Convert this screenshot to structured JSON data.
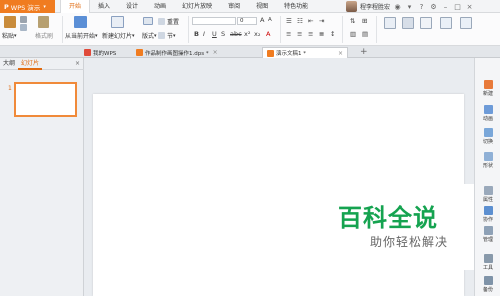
{
  "app": {
    "logo": "P",
    "name": "WPS 演示",
    "arrow": "▾"
  },
  "menu": {
    "tabs": [
      "开始",
      "插入",
      "设计",
      "动画",
      "幻灯片放映",
      "审阅",
      "视图",
      "特色功能"
    ],
    "active_index": 0
  },
  "user": {
    "name": "程李程胜宏"
  },
  "ribbon": {
    "paste": "粘贴",
    "format_painter": "格式刷",
    "from_current": "从当前开始",
    "new_slide": "新建幻灯片",
    "layout": "版式",
    "section": "节",
    "reset": "重置",
    "font_size": "0"
  },
  "doc_tabs": [
    {
      "label": "我的WPS",
      "active": false
    },
    {
      "label": "作品制作画图操作1.dps *",
      "active": false
    },
    {
      "label": "演示文稿1 *",
      "active": true
    }
  ],
  "left_panel": {
    "tabs": [
      "大纲",
      "幻灯片"
    ],
    "active_index": 1,
    "slide_number": "1"
  },
  "right_bar": {
    "items": [
      "新建",
      "动画",
      "切换",
      "形状",
      "属性",
      "协作",
      "管理",
      "工具",
      "备份"
    ]
  },
  "watermark": {
    "title": "百科全说",
    "subtitle": "助你轻松解决"
  },
  "colors": {
    "accent": "#f07c20",
    "watermark_green": "#15a350"
  }
}
